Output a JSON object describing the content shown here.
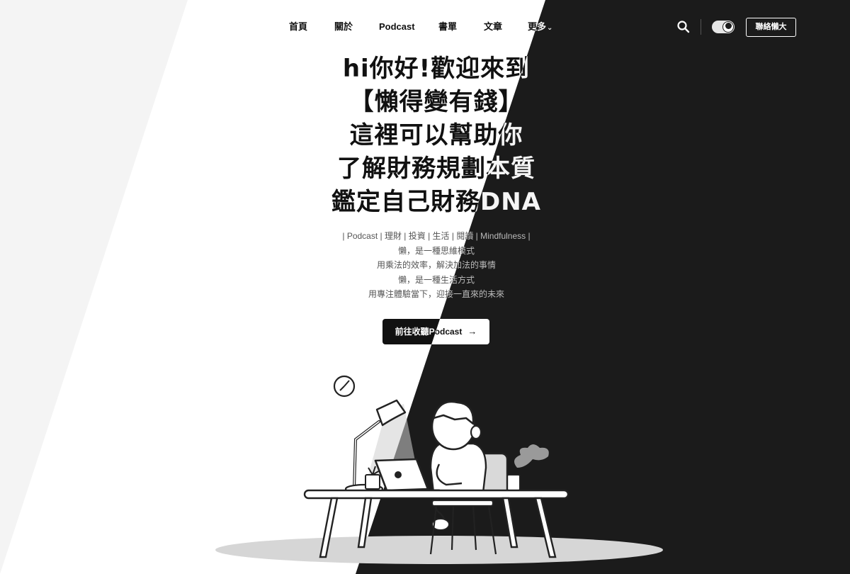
{
  "nav": {
    "items": [
      {
        "label": "首頁"
      },
      {
        "label": "關於"
      },
      {
        "label": "Podcast"
      },
      {
        "label": "書單"
      },
      {
        "label": "文章"
      },
      {
        "label": "更多"
      }
    ],
    "more_chevron": "⌄",
    "search_icon": "search-icon",
    "theme_toggle_icon": "moon-toggle-icon",
    "contact_label": "聯絡懶大"
  },
  "hero": {
    "headline_lines": [
      "hi你好!歡迎來到",
      "【懶得變有錢】",
      "這裡可以幫助你",
      "了解財務規劃本質",
      "鑑定自己財務DNA"
    ],
    "subtitle_lines": [
      "| Podcast | 理財 | 投資 | 生活 | 閱讀 | Mindfulness |",
      "懶，是一種思維模式",
      "用乘法的效率，解決加法的事情",
      "懶，是一種生活方式",
      "用專注體驗當下，迎接一直來的未來"
    ],
    "cta_label": "前往收聽Podcast",
    "cta_arrow": "→"
  },
  "colors": {
    "light_bg": "#ffffff",
    "dark_bg": "#1b1b1b",
    "text_dark": "#111111",
    "text_light": "#f5f5f5"
  }
}
